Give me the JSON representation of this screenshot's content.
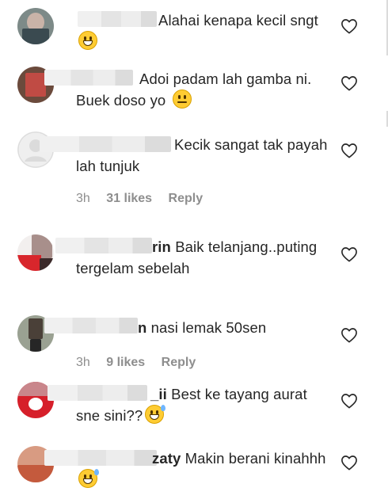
{
  "comments": [
    {
      "username_tail": "",
      "text": "Alahai kenapa kecil sngt",
      "emoji": "grin-emoji"
    },
    {
      "username_tail": "",
      "text": "Adoi padam lah gamba ni. Buek doso yo",
      "emoji": "relieved-emoji"
    },
    {
      "username_tail": "",
      "text": "Kecik sangat tak payah lah tunjuk",
      "time": "3h",
      "likes": "31 likes",
      "reply": "Reply"
    },
    {
      "username_tail": "rin",
      "text": "Baik telanjang..puting tergelam sebelah"
    },
    {
      "username_tail": "n",
      "text": "nasi lemak 50sen",
      "time": "3h",
      "likes": "9 likes",
      "reply": "Reply"
    },
    {
      "username_tail": "_ii",
      "text": "Best ke tayang aurat sne sini??",
      "emoji": "sweat-smile-emoji"
    },
    {
      "username_tail": "zaty",
      "text": "Makin berani kinahhh",
      "emoji": "sweat-smile-emoji"
    }
  ],
  "colors": {
    "text": "#262626",
    "meta": "#8e8e8e",
    "heart": "#262626",
    "emoji": "#ffcc33"
  }
}
